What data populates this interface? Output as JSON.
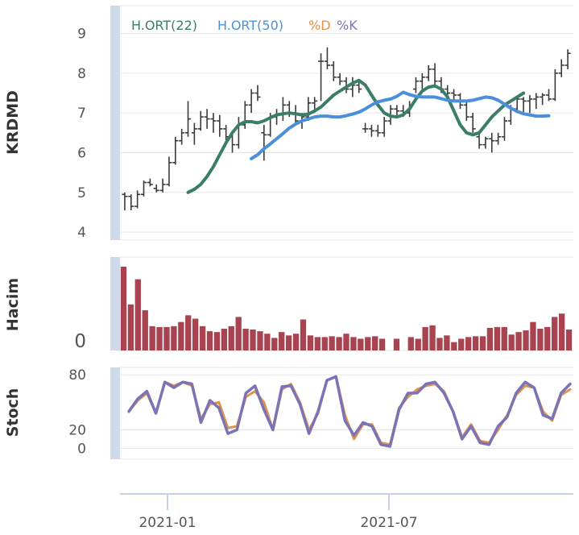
{
  "chart_data": [
    {
      "type": "ohlc",
      "panel": "price",
      "ylabel": "KRDMD",
      "ylim": [
        3.8,
        9.7
      ],
      "yticks": [
        4,
        5,
        6,
        7,
        8,
        9
      ],
      "grid": true,
      "legend": {
        "placement": "top-left",
        "entries": [
          {
            "label": "H.ORT(22)",
            "color": "#3a7d68"
          },
          {
            "label": "H.ORT(50)",
            "color": "#4a90d9"
          },
          {
            "label": "%D",
            "color": "#e0914a"
          },
          {
            "label": "%K",
            "color": "#7b73b5"
          }
        ]
      },
      "candles": [
        [
          4.95,
          5.0,
          4.55,
          4.9
        ],
        [
          4.9,
          4.95,
          4.55,
          4.65
        ],
        [
          4.65,
          5.05,
          4.6,
          4.95
        ],
        [
          4.95,
          5.3,
          4.9,
          5.25
        ],
        [
          5.25,
          5.35,
          5.15,
          5.2
        ],
        [
          5.1,
          5.2,
          5.0,
          5.05
        ],
        [
          5.05,
          5.35,
          5.0,
          5.2
        ],
        [
          5.2,
          5.9,
          5.15,
          5.75
        ],
        [
          5.75,
          6.4,
          5.7,
          6.3
        ],
        [
          6.3,
          6.6,
          6.2,
          6.5
        ],
        [
          6.5,
          7.3,
          6.4,
          6.85
        ],
        [
          6.5,
          6.75,
          6.2,
          6.6
        ],
        [
          6.6,
          7.05,
          6.55,
          6.9
        ],
        [
          6.9,
          7.1,
          6.6,
          6.85
        ],
        [
          6.85,
          7.0,
          6.5,
          6.8
        ],
        [
          6.8,
          6.95,
          6.4,
          6.6
        ],
        [
          6.6,
          6.7,
          6.3,
          6.4
        ],
        [
          6.4,
          6.5,
          6.0,
          6.2
        ],
        [
          6.2,
          6.9,
          6.1,
          6.7
        ],
        [
          6.7,
          7.3,
          6.6,
          7.2
        ],
        [
          7.2,
          7.6,
          7.0,
          7.5
        ],
        [
          7.5,
          7.7,
          7.3,
          7.4
        ],
        [
          6.5,
          6.7,
          5.8,
          6.45
        ],
        [
          6.45,
          7.0,
          6.4,
          6.9
        ],
        [
          6.9,
          7.1,
          6.7,
          6.95
        ],
        [
          6.95,
          7.4,
          6.8,
          7.2
        ],
        [
          7.2,
          7.3,
          6.9,
          7.0
        ],
        [
          7.0,
          7.2,
          6.7,
          6.8
        ],
        [
          6.8,
          7.0,
          6.6,
          6.9
        ],
        [
          6.9,
          7.4,
          6.8,
          7.25
        ],
        [
          7.25,
          7.4,
          7.0,
          7.3
        ],
        [
          8.3,
          8.5,
          7.3,
          8.3
        ],
        [
          8.3,
          8.65,
          8.1,
          8.2
        ],
        [
          8.2,
          8.3,
          7.8,
          7.9
        ],
        [
          7.9,
          8.0,
          7.7,
          7.8
        ],
        [
          7.8,
          7.9,
          7.5,
          7.6
        ],
        [
          7.6,
          7.9,
          7.4,
          7.7
        ],
        [
          7.7,
          7.8,
          7.5,
          7.6
        ],
        [
          6.6,
          6.75,
          6.5,
          6.6
        ],
        [
          6.6,
          6.7,
          6.4,
          6.55
        ],
        [
          6.55,
          6.7,
          6.4,
          6.5
        ],
        [
          6.5,
          6.9,
          6.4,
          6.8
        ],
        [
          6.8,
          7.2,
          6.7,
          7.1
        ],
        [
          7.1,
          7.2,
          6.9,
          7.05
        ],
        [
          7.05,
          7.2,
          6.9,
          7.0
        ],
        [
          7.0,
          7.3,
          6.9,
          7.2
        ],
        [
          7.6,
          7.9,
          7.5,
          7.8
        ],
        [
          7.8,
          8.0,
          7.6,
          7.9
        ],
        [
          7.9,
          8.2,
          7.8,
          8.1
        ],
        [
          8.1,
          8.25,
          7.7,
          7.8
        ],
        [
          7.8,
          7.9,
          7.5,
          7.6
        ],
        [
          7.6,
          7.7,
          7.4,
          7.5
        ],
        [
          7.5,
          7.6,
          7.3,
          7.45
        ],
        [
          7.45,
          7.5,
          7.1,
          7.2
        ],
        [
          7.2,
          7.3,
          6.8,
          6.9
        ],
        [
          6.9,
          7.0,
          6.5,
          6.6
        ],
        [
          6.4,
          6.5,
          6.1,
          6.2
        ],
        [
          6.2,
          6.4,
          6.1,
          6.35
        ],
        [
          6.35,
          6.5,
          6.0,
          6.3
        ],
        [
          6.3,
          6.5,
          6.2,
          6.4
        ],
        [
          6.4,
          6.9,
          6.3,
          6.8
        ],
        [
          6.8,
          7.2,
          6.7,
          7.1
        ],
        [
          7.1,
          7.4,
          7.0,
          7.35
        ],
        [
          7.35,
          7.4,
          7.0,
          7.3
        ],
        [
          7.3,
          7.45,
          7.0,
          7.35
        ],
        [
          7.35,
          7.5,
          7.1,
          7.4
        ],
        [
          7.4,
          7.5,
          7.2,
          7.45
        ],
        [
          7.45,
          7.6,
          7.3,
          7.35
        ],
        [
          7.35,
          8.1,
          7.3,
          8.0
        ],
        [
          8.0,
          8.35,
          7.9,
          8.2
        ],
        [
          8.2,
          8.6,
          8.1,
          8.5
        ]
      ],
      "series": [
        {
          "name": "H.ORT(22)",
          "start_index": 10,
          "values": [
            5.0,
            5.08,
            5.2,
            5.4,
            5.65,
            5.95,
            6.25,
            6.5,
            6.7,
            6.78,
            6.78,
            6.75,
            6.8,
            6.88,
            6.95,
            6.98,
            7.0,
            6.98,
            6.95,
            6.97,
            7.05,
            7.15,
            7.3,
            7.45,
            7.55,
            7.65,
            7.75,
            7.82,
            7.7,
            7.45,
            7.2,
            7.0,
            6.92,
            6.9,
            6.95,
            7.1,
            7.35,
            7.55,
            7.65,
            7.68,
            7.6,
            7.4,
            7.05,
            6.7,
            6.5,
            6.45,
            6.5,
            6.7,
            6.9,
            7.05,
            7.2,
            7.3,
            7.4,
            7.5
          ]
        },
        {
          "name": "H.ORT(50)",
          "start_index": 20,
          "values": [
            5.85,
            5.95,
            6.1,
            6.22,
            6.35,
            6.48,
            6.62,
            6.72,
            6.8,
            6.85,
            6.9,
            6.92,
            6.92,
            6.9,
            6.9,
            6.93,
            6.97,
            7.02,
            7.1,
            7.2,
            7.28,
            7.32,
            7.35,
            7.42,
            7.52,
            7.46,
            7.42,
            7.4,
            7.4,
            7.4,
            7.36,
            7.32,
            7.3,
            7.3,
            7.3,
            7.32,
            7.36,
            7.4,
            7.38,
            7.32,
            7.22,
            7.12,
            7.04,
            6.98,
            6.95,
            6.92,
            6.92,
            6.93
          ]
        }
      ]
    },
    {
      "type": "bar",
      "panel": "volume",
      "ylabel": "Hacim",
      "yticks": [
        0
      ],
      "values": [
        100,
        55,
        85,
        48,
        29,
        28,
        28,
        29,
        34,
        42,
        38,
        29,
        23,
        22,
        26,
        29,
        40,
        26,
        25,
        23,
        20,
        15,
        22,
        18,
        20,
        37,
        18,
        16,
        16,
        17,
        16,
        20,
        16,
        14,
        16,
        17,
        14,
        0,
        14,
        0,
        16,
        14,
        28,
        30,
        15,
        18,
        10,
        14,
        16,
        17,
        17,
        27,
        28,
        28,
        19,
        22,
        24,
        34,
        26,
        28,
        40,
        44,
        25
      ],
      "bar_color": "#a8434f"
    },
    {
      "type": "line",
      "panel": "stochastic",
      "ylabel": "Stoch",
      "ylim": [
        -12,
        88
      ],
      "yticks": [
        0,
        20,
        80
      ],
      "series": [
        {
          "name": "%D",
          "color": "#e0914a",
          "values": [
            40,
            52,
            60,
            38,
            72,
            68,
            72,
            68,
            32,
            48,
            50,
            22,
            24,
            56,
            62,
            50,
            20,
            64,
            70,
            50,
            20,
            38,
            74,
            78,
            36,
            10,
            26,
            26,
            6,
            4,
            44,
            56,
            64,
            68,
            70,
            62,
            40,
            12,
            26,
            8,
            6,
            20,
            36,
            58,
            68,
            66,
            40,
            30,
            58,
            64
          ]
        },
        {
          "name": "%K",
          "color": "#7b73b5",
          "values": [
            40,
            54,
            62,
            38,
            72,
            66,
            72,
            70,
            28,
            52,
            44,
            16,
            20,
            60,
            68,
            42,
            20,
            67,
            68,
            48,
            16,
            40,
            74,
            78,
            30,
            14,
            28,
            24,
            4,
            2,
            42,
            60,
            60,
            70,
            72,
            60,
            40,
            10,
            24,
            6,
            4,
            24,
            34,
            60,
            72,
            66,
            36,
            32,
            60,
            70
          ]
        }
      ]
    }
  ],
  "xaxis": {
    "tick_labels": [
      "2021-01",
      "2021-07"
    ]
  }
}
